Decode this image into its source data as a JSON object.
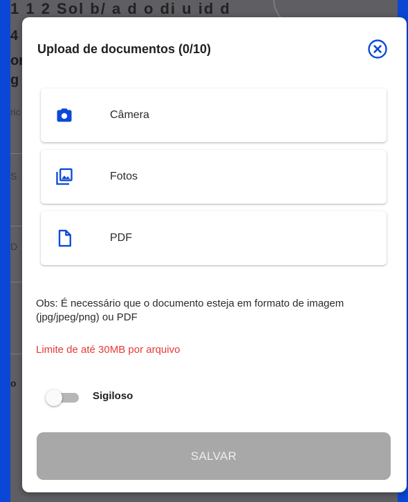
{
  "background": {
    "top_line": "1 1 2 Sol b/   a  d    o  di    u  id d",
    "fragments": [
      "4",
      "or",
      "g",
      "ric",
      "S",
      "D",
      "o"
    ]
  },
  "dialog": {
    "title": "Upload de documentos (0/10)",
    "close_icon": "close-circle-icon",
    "options": [
      {
        "label": "Câmera",
        "icon": "camera-icon"
      },
      {
        "label": "Fotos",
        "icon": "photo-library-icon"
      },
      {
        "label": "PDF",
        "icon": "file-icon"
      }
    ],
    "obs": "Obs: É necessário que o documento esteja em formato de imagem (jpg/jpeg/png) ou PDF",
    "limit": "Limite de até 30MB por arquivo",
    "toggle": {
      "label": "Sigiloso",
      "checked": false
    },
    "save_label": "SALVAR"
  },
  "colors": {
    "accent": "#0b49d8",
    "warning": "#e53935",
    "disabled_button": "#a8a8a8",
    "page_background": "#0a47d6"
  }
}
